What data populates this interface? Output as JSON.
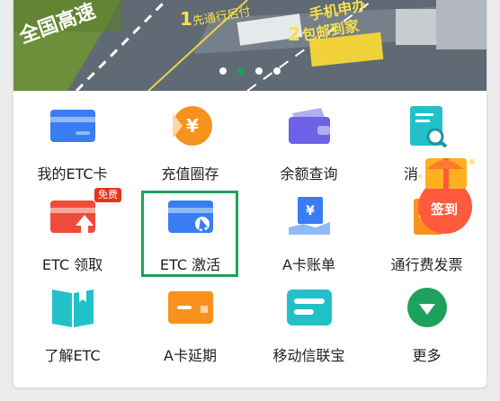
{
  "banner": {
    "line1_num": "1",
    "line1_text": "先通行后付",
    "line2_num": "2",
    "line2_text": "包邮到家",
    "top_text": "手机申办",
    "left_text": "全国高速",
    "dots": [
      false,
      true,
      false,
      false
    ]
  },
  "menu": {
    "row1": [
      "我的ETC卡",
      "充值圈存",
      "余额查询",
      "消"
    ],
    "row2": [
      "ETC 领取",
      "ETC 激活",
      "A卡账单",
      "通行费发票"
    ],
    "row3": [
      "了解ETC",
      "A卡延期",
      "移动信联宝",
      "更多"
    ],
    "free_badge": "免费",
    "yen": "¥"
  },
  "checkin": {
    "label": "签到"
  },
  "colors": {
    "accent_green": "#1ea15c",
    "blue": "#3a7cf2",
    "orange": "#f7921e",
    "purple": "#6b62e6",
    "teal": "#22c1c9",
    "red": "#f04a3b"
  }
}
